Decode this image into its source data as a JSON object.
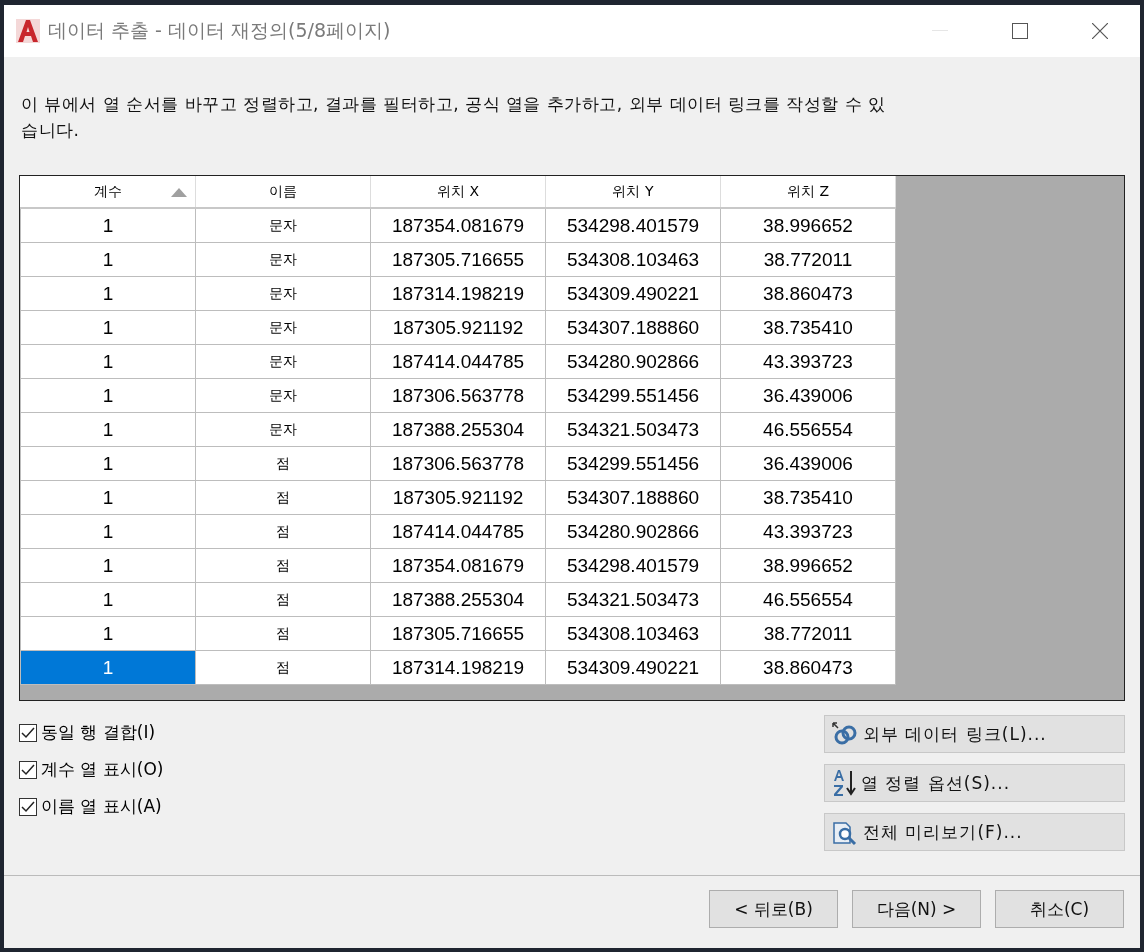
{
  "window": {
    "title": "데이터 추출 - 데이터 재정의(5/8페이지)"
  },
  "description": "이 뷰에서 열 순서를 바꾸고 정렬하고, 결과를 필터하고, 공식 열을 추가하고, 외부 데이터 링크를 작성할 수 있습니다.",
  "table": {
    "columns": [
      {
        "label": "계수",
        "sorted": true
      },
      {
        "label": "이름",
        "sorted": false
      },
      {
        "label": "위치 X",
        "sorted": false
      },
      {
        "label": "위치 Y",
        "sorted": false
      },
      {
        "label": "위치 Z",
        "sorted": false
      }
    ],
    "rows": [
      {
        "selected": false,
        "cells": [
          "1",
          "문자",
          "187354.081679",
          "534298.401579",
          "38.996652"
        ]
      },
      {
        "selected": false,
        "cells": [
          "1",
          "문자",
          "187305.716655",
          "534308.103463",
          "38.772011"
        ]
      },
      {
        "selected": false,
        "cells": [
          "1",
          "문자",
          "187314.198219",
          "534309.490221",
          "38.860473"
        ]
      },
      {
        "selected": false,
        "cells": [
          "1",
          "문자",
          "187305.921192",
          "534307.188860",
          "38.735410"
        ]
      },
      {
        "selected": false,
        "cells": [
          "1",
          "문자",
          "187414.044785",
          "534280.902866",
          "43.393723"
        ]
      },
      {
        "selected": false,
        "cells": [
          "1",
          "문자",
          "187306.563778",
          "534299.551456",
          "36.439006"
        ]
      },
      {
        "selected": false,
        "cells": [
          "1",
          "문자",
          "187388.255304",
          "534321.503473",
          "46.556554"
        ]
      },
      {
        "selected": false,
        "cells": [
          "1",
          "점",
          "187306.563778",
          "534299.551456",
          "36.439006"
        ]
      },
      {
        "selected": false,
        "cells": [
          "1",
          "점",
          "187305.921192",
          "534307.188860",
          "38.735410"
        ]
      },
      {
        "selected": false,
        "cells": [
          "1",
          "점",
          "187414.044785",
          "534280.902866",
          "43.393723"
        ]
      },
      {
        "selected": false,
        "cells": [
          "1",
          "점",
          "187354.081679",
          "534298.401579",
          "38.996652"
        ]
      },
      {
        "selected": false,
        "cells": [
          "1",
          "점",
          "187388.255304",
          "534321.503473",
          "46.556554"
        ]
      },
      {
        "selected": false,
        "cells": [
          "1",
          "점",
          "187305.716655",
          "534308.103463",
          "38.772011"
        ]
      },
      {
        "selected": true,
        "cells": [
          "1",
          "점",
          "187314.198219",
          "534309.490221",
          "38.860473"
        ]
      }
    ]
  },
  "options": [
    {
      "label": "동일 행 결합(I)",
      "checked": true
    },
    {
      "label": "계수 열 표시(O)",
      "checked": true
    },
    {
      "label": "이름 열 표시(A)",
      "checked": true
    }
  ],
  "side_buttons": [
    {
      "label": "외부 데이터 링크(L)...",
      "kind": "link"
    },
    {
      "label": "열 정렬 옵션(S)...",
      "kind": "sort"
    },
    {
      "label": "전체 미리보기(F)...",
      "kind": "preview"
    }
  ],
  "footer_buttons": [
    "< 뒤로(B)",
    "다음(N) >",
    "취소(C)"
  ]
}
